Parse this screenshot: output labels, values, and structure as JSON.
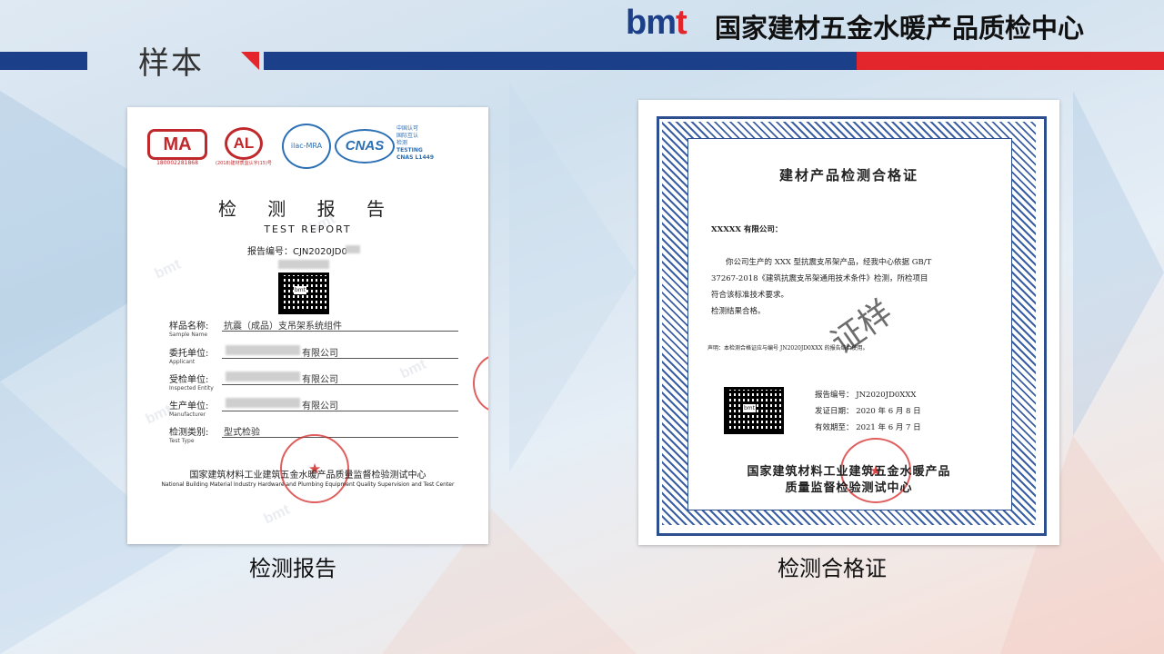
{
  "header": {
    "section_title": "样本",
    "brand_logo_main": "bm",
    "brand_logo_accent": "t",
    "org_name": "国家建材五金水暖产品质检中心",
    "colors": {
      "blue": "#1c3f8a",
      "red": "#e3262b"
    }
  },
  "report": {
    "caption": "检测报告",
    "logos": {
      "cma_text": "MA",
      "cma_number": "180002281868",
      "cal_text": "AL",
      "cal_number": "(2018)建材质监认字(15)号",
      "ilac_text": "ilac-MRA",
      "cnas_text": "CNAS",
      "cnas_desc": [
        "中国认可",
        "国际互认",
        "检测",
        "TESTING",
        "CNAS L1449"
      ]
    },
    "title": "检 测 报 告",
    "subtitle": "TEST   REPORT",
    "report_no": "报告编号：CJN2020JD0",
    "fields": [
      {
        "label": "样品名称:",
        "en": "Sample Name",
        "value": "抗震（成品）支吊架系统组件"
      },
      {
        "label": "委托单位:",
        "en": "Applicant",
        "value": "有限公司"
      },
      {
        "label": "受检单位:",
        "en": "Inspected Entity",
        "value": "有限公司"
      },
      {
        "label": "生产单位:",
        "en": "Manufacturer",
        "value": "有限公司"
      },
      {
        "label": "检测类别:",
        "en": "Test Type",
        "value": "型式检验"
      }
    ],
    "org": "国家建筑材料工业建筑五金水暖产品质量监督检验测试中心",
    "org_en": "National Building Material Industry Hardware and Plumbing Equipment Quality Supervision and Test Center",
    "qr_label": "bmt",
    "watermark": "bmt"
  },
  "cert": {
    "caption": "检测合格证",
    "title": "建材产品检测合格证",
    "addressee": "XXXXX 有限公司：",
    "body_lines": [
      "你公司生产的 XXX 型抗震支吊架产品，经我中心依据 GB/T",
      "37267-2018《建筑抗震支吊架通用技术条件》检测，所检项目",
      "符合该标准技术要求。",
      "检测结果合格。"
    ],
    "stamp": "证样",
    "declaration": "声明：本检测合格证应与编号 JN2020JD0XXX 的报告结合使用。",
    "info": [
      "报告编号： JN2020JD0XXX",
      "发证日期： 2020 年 6 月 8 日",
      "有效期至： 2021 年 6 月 7 日"
    ],
    "org_line1": "国家建筑材料工业建筑五金水暖产品",
    "org_line2": "质量监督检验测试中心",
    "qr_label": "bmt"
  }
}
